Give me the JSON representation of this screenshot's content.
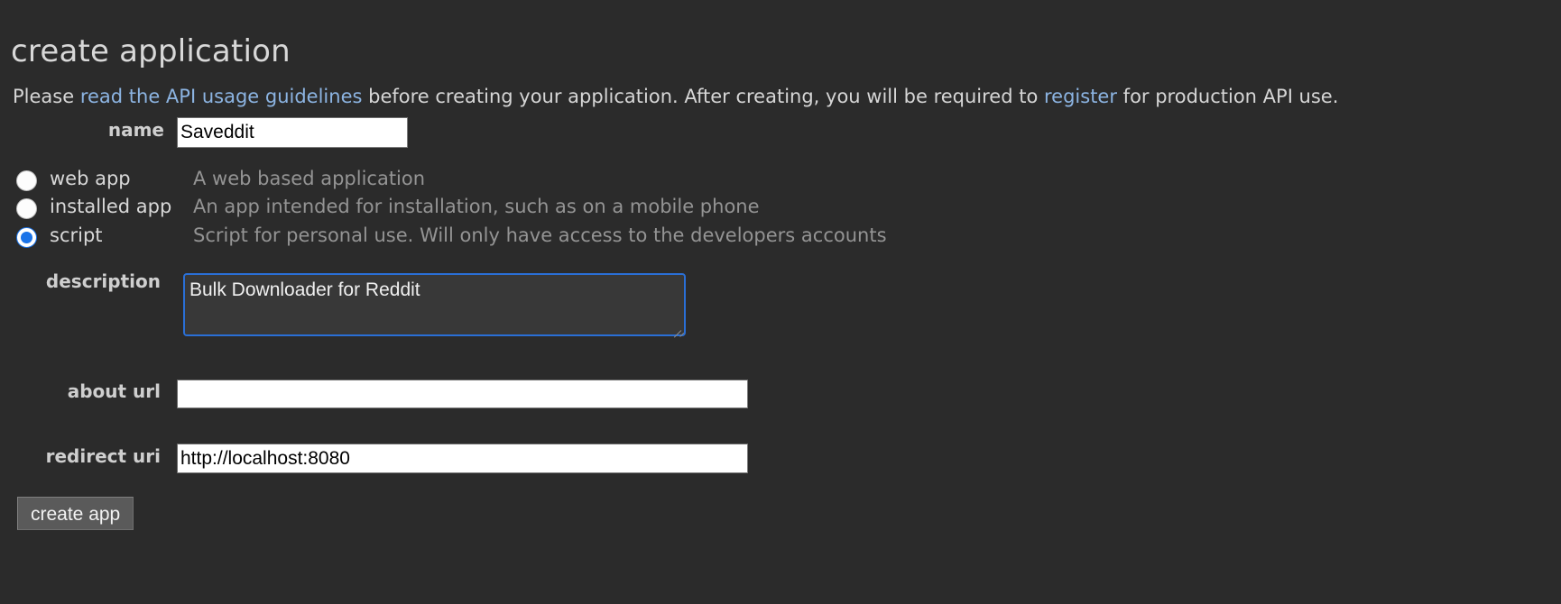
{
  "page": {
    "title": "create application",
    "intro": {
      "before_link": "Please ",
      "link_guidelines": "read the API usage guidelines",
      "middle": " before creating your application. After creating, you will be required to ",
      "link_register": "register",
      "after": " for production API use."
    }
  },
  "form": {
    "name": {
      "label": "name",
      "value": "Saveddit",
      "placeholder": ""
    },
    "app_types": [
      {
        "id": "web-app",
        "label": "web app",
        "description": "A web based application",
        "checked": false
      },
      {
        "id": "installed-app",
        "label": "installed app",
        "description": "An app intended for installation, such as on a mobile phone",
        "checked": false
      },
      {
        "id": "script",
        "label": "script",
        "description": "Script for personal use. Will only have access to the developers accounts",
        "checked": true
      }
    ],
    "description": {
      "label": "description",
      "value": "Bulk Downloader for Reddit",
      "placeholder": ""
    },
    "about_url": {
      "label": "about url",
      "value": "",
      "placeholder": ""
    },
    "redirect_uri": {
      "label": "redirect uri",
      "value": "http://localhost:8080",
      "placeholder": ""
    },
    "submit_label": "create app"
  },
  "colors": {
    "background": "#2b2b2b",
    "text": "#d6d6d6",
    "muted_text": "#949494",
    "link": "#8cb4e2",
    "focus_border": "#2a6fd6",
    "radio_accent": "#1a73e8",
    "button_background": "#5a5a5a"
  }
}
